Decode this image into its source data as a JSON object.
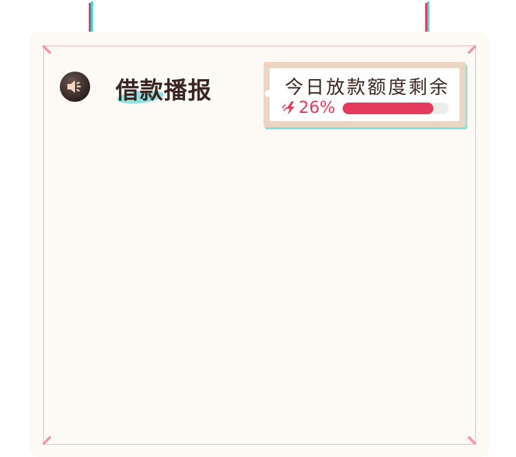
{
  "header": {
    "title": "借款播报",
    "speaker_icon": "speaker-icon"
  },
  "quota": {
    "title": "今日放款额度剩余",
    "percent_text": "26%",
    "icon": "lightning-icon",
    "bar_fill_percent": 86
  },
  "colors": {
    "accent_red": "#e8395a",
    "accent_cyan": "#29e0e0",
    "card_bg": "#fdf9f4",
    "title_brown": "#3a2521"
  }
}
